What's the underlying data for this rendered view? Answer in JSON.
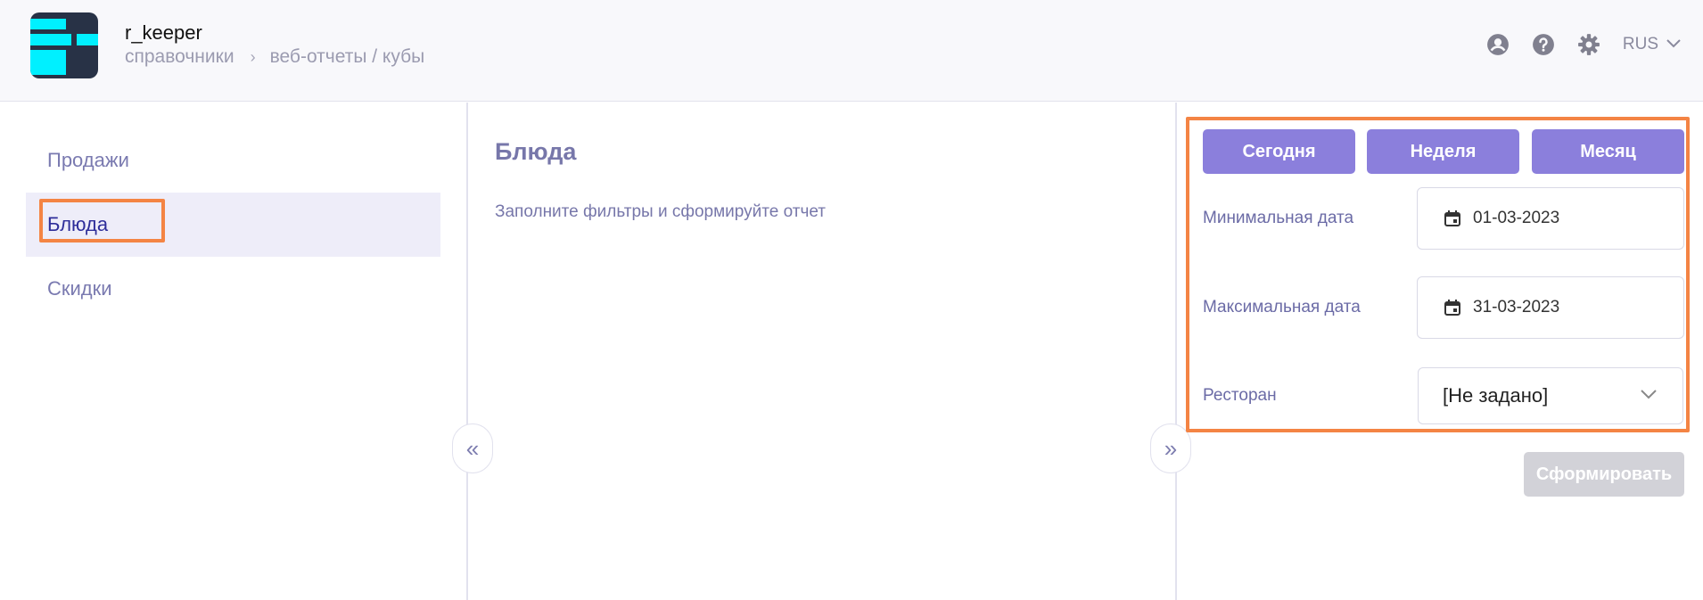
{
  "header": {
    "app_title": "r_keeper",
    "breadcrumb": [
      "справочники",
      "веб-отчеты / кубы"
    ],
    "breadcrumb_sep": "›",
    "language": "RUS"
  },
  "sidebar": {
    "items": [
      {
        "label": "Продажи",
        "active": false
      },
      {
        "label": "Блюда",
        "active": true
      },
      {
        "label": "Скидки",
        "active": false
      }
    ]
  },
  "main": {
    "title": "Блюда",
    "hint": "Заполните фильтры и сформируйте отчет"
  },
  "collapse": {
    "left": "«",
    "right": "»"
  },
  "filters": {
    "period_buttons": [
      "Сегодня",
      "Неделя",
      "Месяц"
    ],
    "min_date_label": "Минимальная дата",
    "min_date_value": "01-03-2023",
    "max_date_label": "Максимальная дата",
    "max_date_value": "31-03-2023",
    "restaurant_label": "Ресторан",
    "restaurant_value": "[Не задано]",
    "submit_label": "Сформировать"
  },
  "colors": {
    "accent": "#8b7fdc",
    "highlight": "#f48444",
    "logo_bg": "#283246",
    "logo_fg": "#00f0ff",
    "disabled": "#d2d2d8"
  },
  "icons": [
    "user-icon",
    "help-icon",
    "gear-icon",
    "chevron-down-icon",
    "calendar-icon"
  ]
}
